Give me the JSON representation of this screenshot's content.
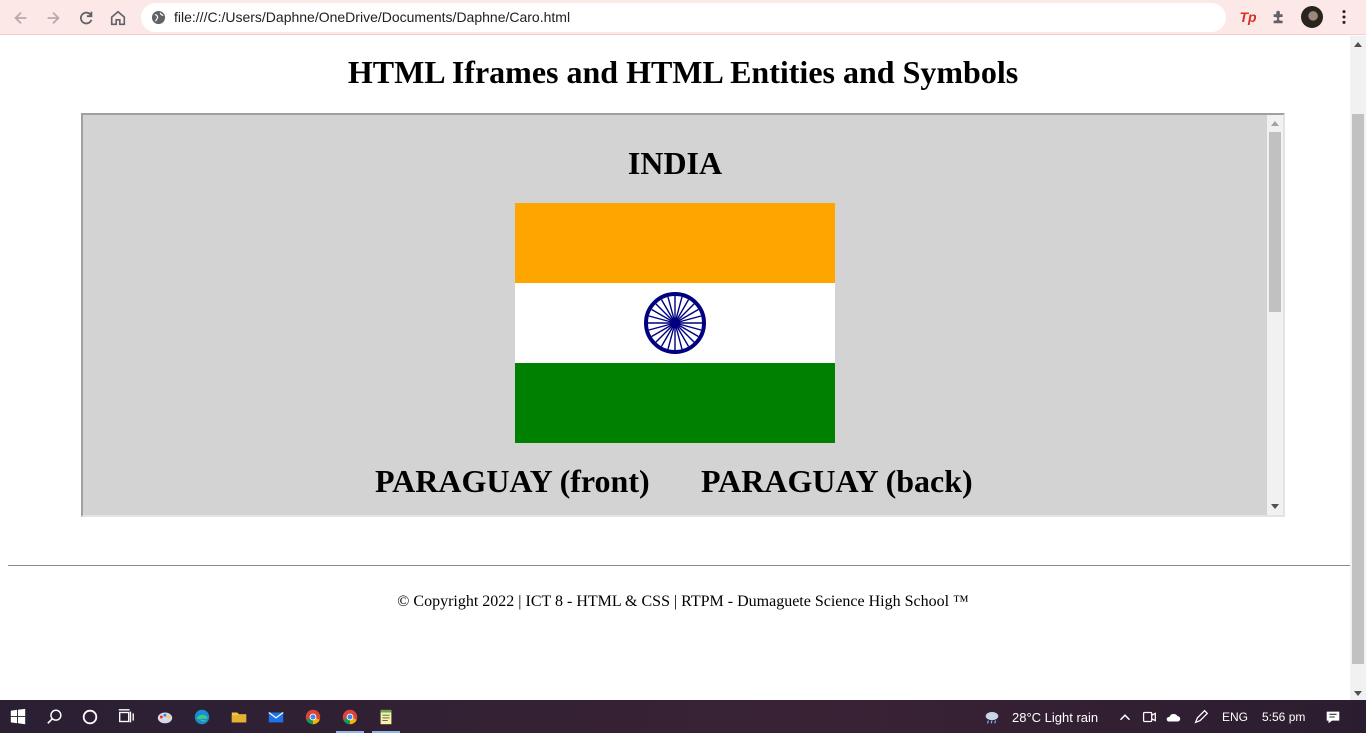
{
  "browser": {
    "url": "file:///C:/Users/Daphne/OneDrive/Documents/Daphne/Caro.html",
    "extension_label": "Tp"
  },
  "page": {
    "title": "HTML Iframes and HTML Entities and Symbols",
    "iframe": {
      "country_heading": "INDIA",
      "flag_colors": {
        "top": "#ffa500",
        "middle": "#ffffff",
        "bottom": "#008000",
        "chakra": "#000080"
      },
      "caption_front": "PARAGUAY (front)",
      "caption_back": "PARAGUAY (back)"
    },
    "footer": "© Copyright 2022 | ICT 8 - HTML & CSS | RTPM - Dumaguete Science High School ™"
  },
  "taskbar": {
    "weather": "28°C  Light rain",
    "language": "ENG",
    "time": "5:56 pm"
  }
}
